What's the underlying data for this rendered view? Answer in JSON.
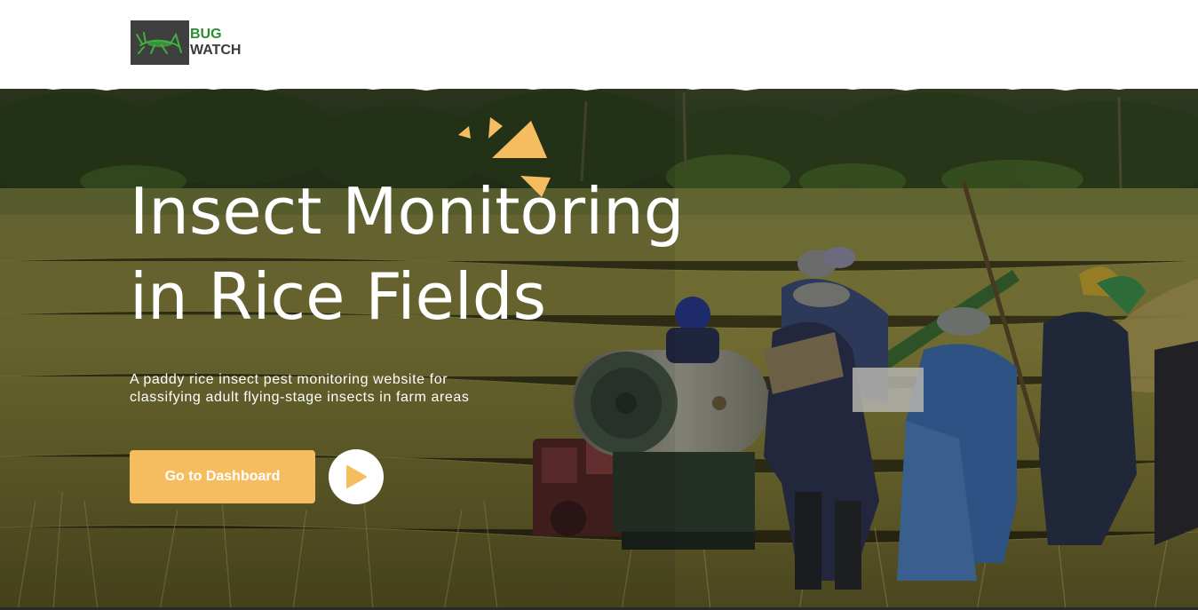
{
  "header": {
    "logo": {
      "line1": "BUG",
      "line2": "WATCH",
      "icon": "grasshopper-icon"
    },
    "colors": {
      "logo_green": "#2e8b2e",
      "logo_bg": "#3f3f3f"
    }
  },
  "hero": {
    "title_line1": "Insect Monitoring",
    "title_line2": "in Rice Fields",
    "subtitle_line1": "A paddy rice insect pest monitoring website for",
    "subtitle_line2": "classifying adult flying-stage insects in farm areas",
    "cta_label": "Go to Dashboard",
    "play_icon": "play-icon",
    "background": "rice-field-harvest-photo",
    "colors": {
      "accent": "#f6bd60",
      "text": "#ffffff"
    }
  }
}
